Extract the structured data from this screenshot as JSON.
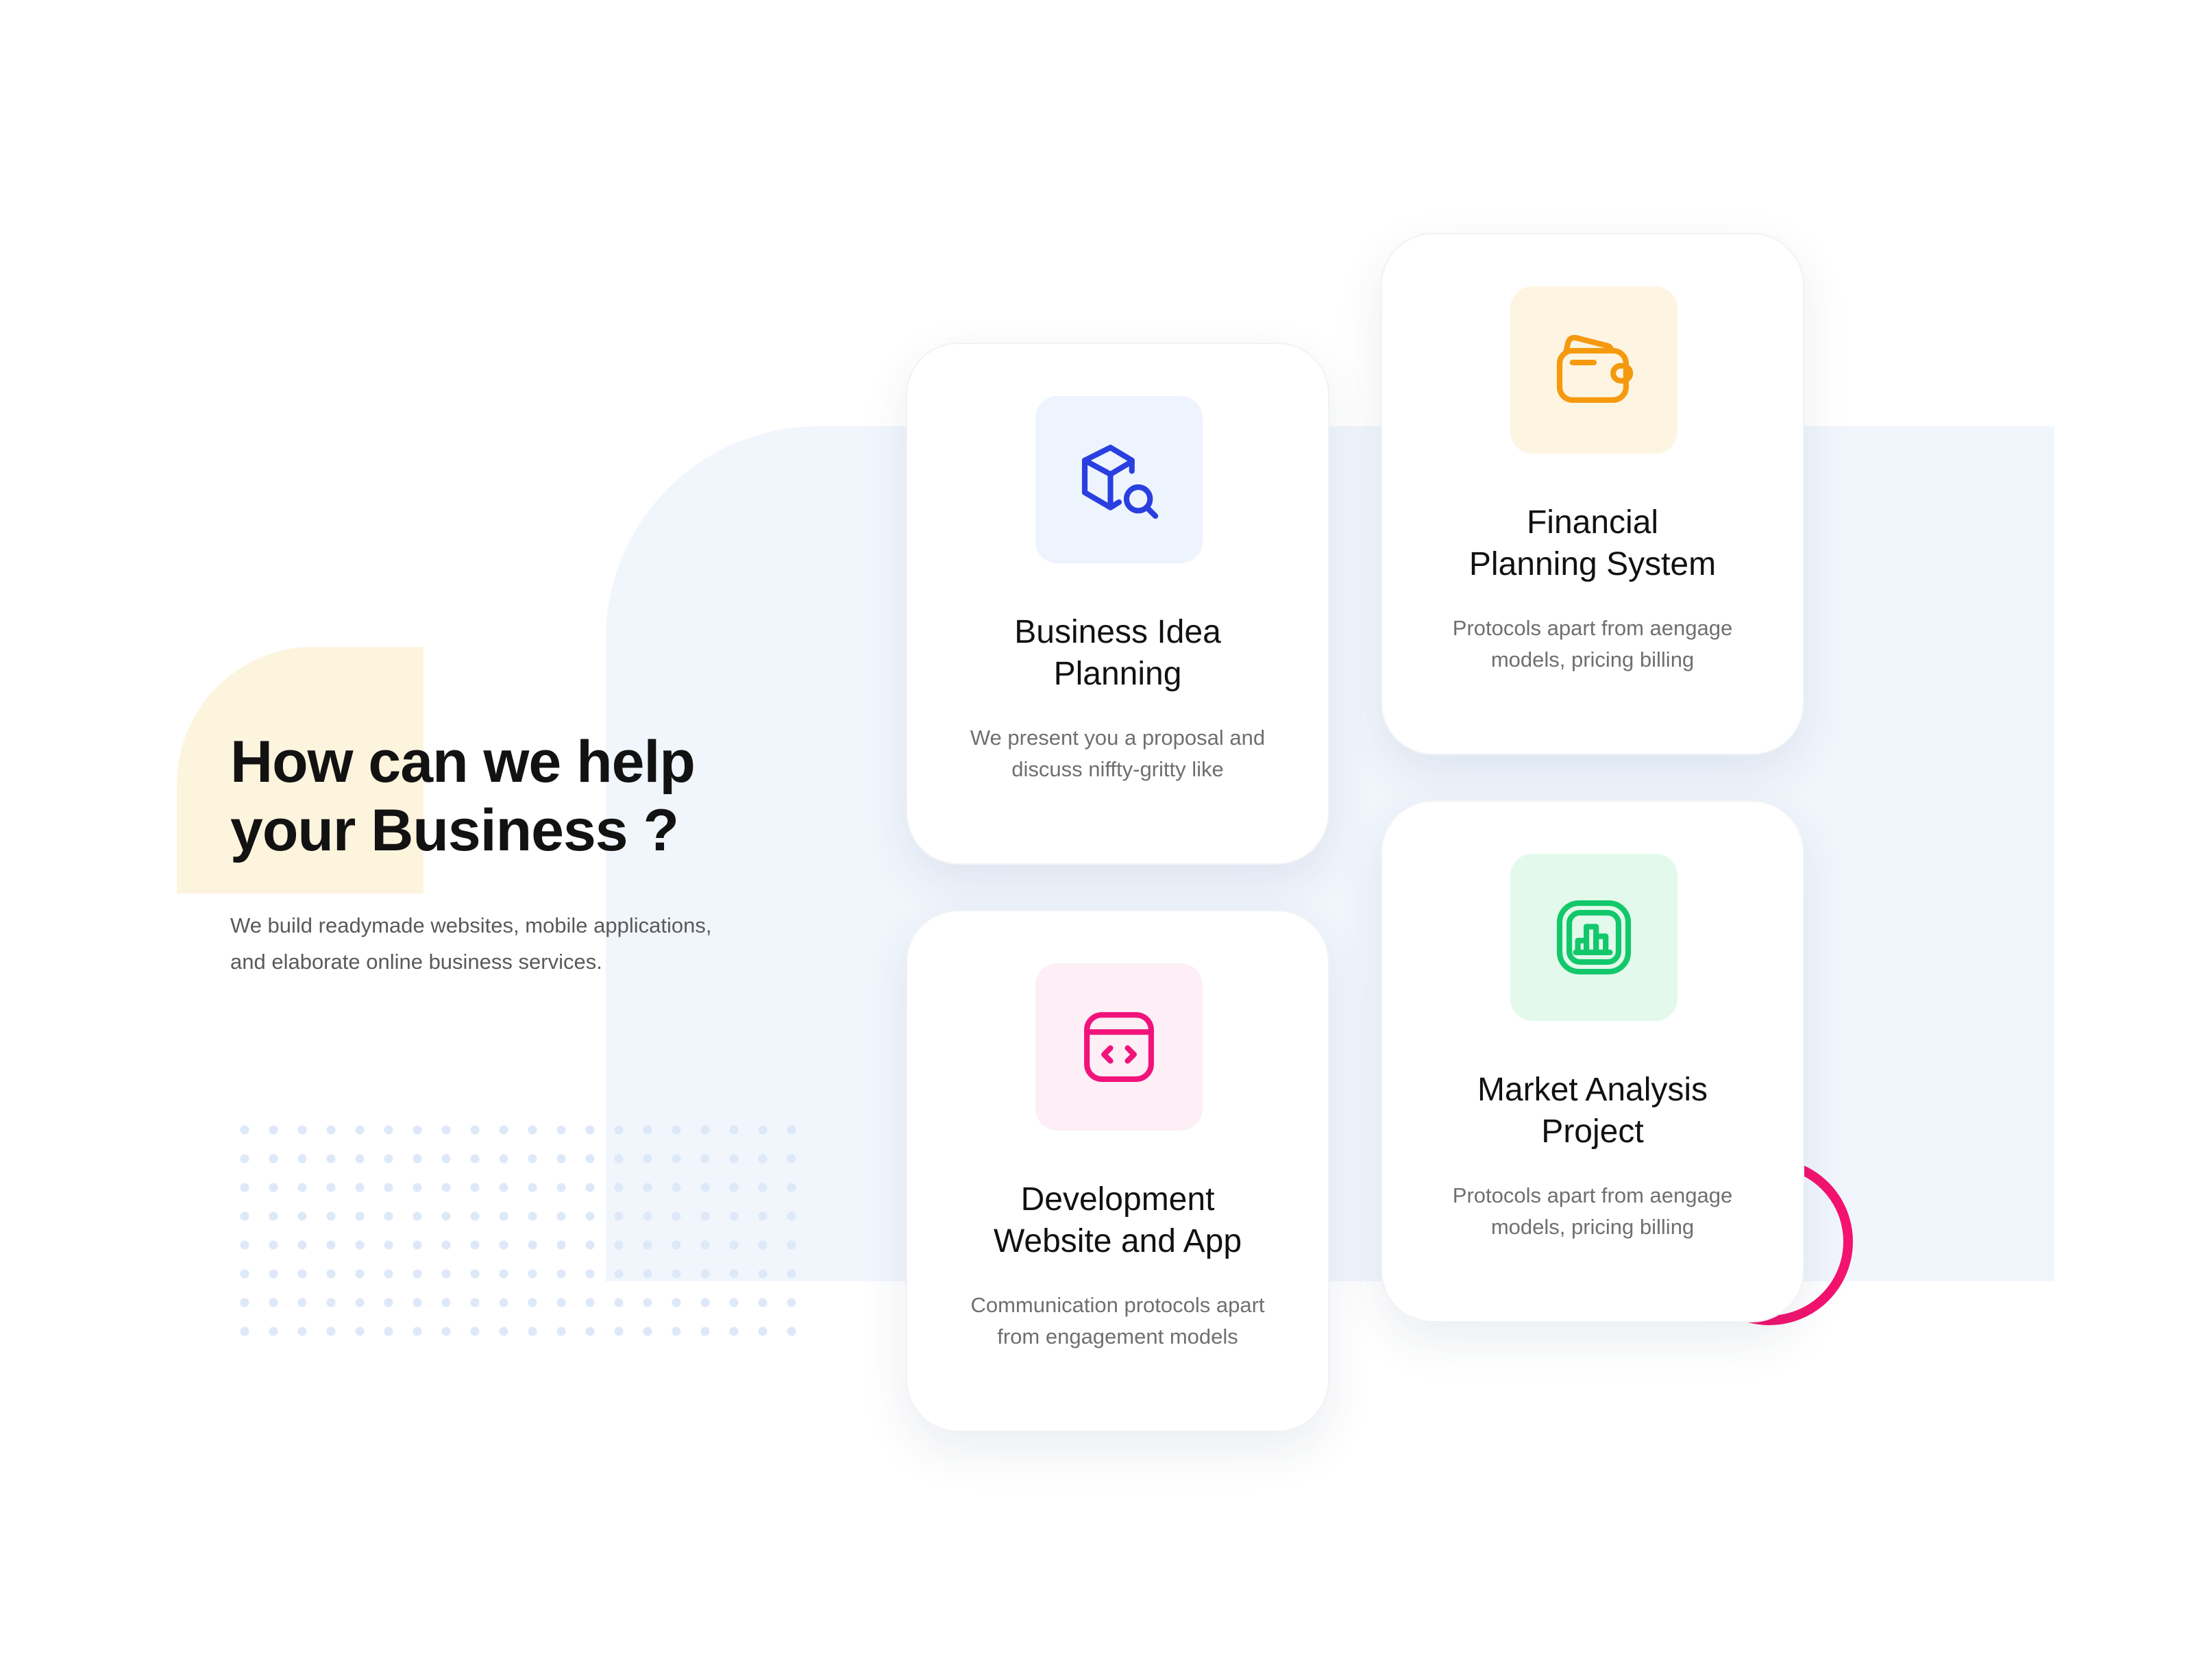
{
  "hero": {
    "title_line1": "How can we help",
    "title_line2": "your Business ?",
    "description_line1": "We build readymade websites, mobile applications,",
    "description_line2": "and elaborate online business services."
  },
  "colors": {
    "panel_bg": "#f1f6fd",
    "deco_yellow": "#fdf4de",
    "accent_pink": "#f4136f",
    "icon_blue": "#2a3fe0",
    "icon_orange": "#f5990f",
    "icon_pink": "#f0137b",
    "icon_green": "#12c86a"
  },
  "cards": [
    {
      "icon": "box-search-icon",
      "title_line1": "Business Idea",
      "title_line2": "Planning",
      "desc_line1": "We present you a proposal and",
      "desc_line2": "discuss niffty-gritty like"
    },
    {
      "icon": "wallet-icon",
      "title_line1": "Financial",
      "title_line2": "Planning System",
      "desc_line1": "Protocols apart from aengage",
      "desc_line2": "models, pricing billing"
    },
    {
      "icon": "code-browser-icon",
      "title_line1": "Development",
      "title_line2": "Website and App",
      "desc_line1": "Communication protocols apart",
      "desc_line2": "from engagement models"
    },
    {
      "icon": "chart-icon",
      "title_line1": "Market Analysis",
      "title_line2": "Project",
      "desc_line1": "Protocols apart from aengage",
      "desc_line2": "models, pricing billing"
    }
  ]
}
